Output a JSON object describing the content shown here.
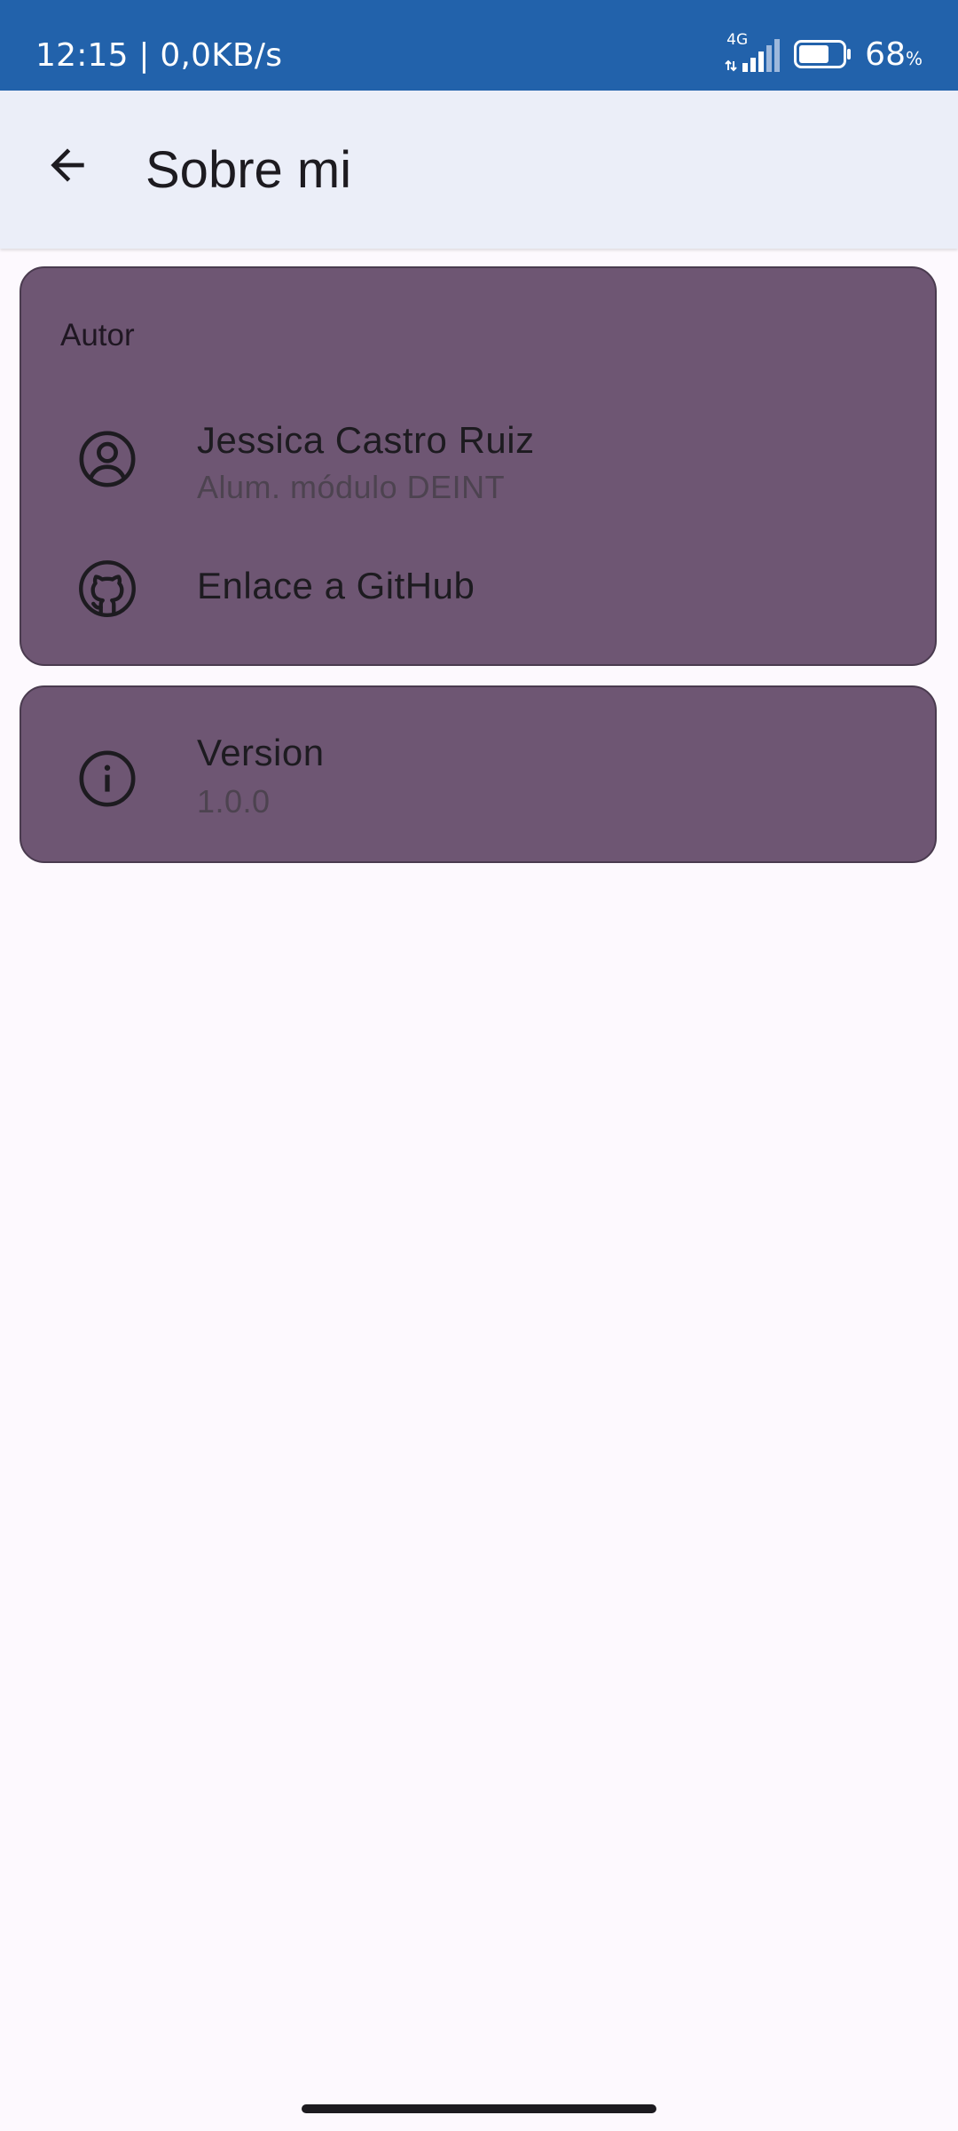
{
  "status_bar": {
    "time_speed": "12:15 | 0,0KB/s",
    "network_type": "4G",
    "battery_percent": "68",
    "battery_percent_sign": "%",
    "battery_level": 0.68,
    "color": "#2262ab"
  },
  "top_bar": {
    "back_icon": "arrow-back-icon",
    "title": "Sobre mi"
  },
  "author_card": {
    "section_title": "Autor",
    "items": [
      {
        "icon": "account-circle-icon",
        "title": "Jessica Castro Ruiz",
        "subtitle": "Alum. módulo DEINT"
      },
      {
        "icon": "github-icon",
        "title": "Enlace a GitHub"
      }
    ]
  },
  "version_card": {
    "icon": "info-icon",
    "title": "Version",
    "subtitle": "1.0.0"
  },
  "colors": {
    "card": "#6e5673",
    "background": "#fdf9fe",
    "top_bar": "#ebeef8"
  }
}
